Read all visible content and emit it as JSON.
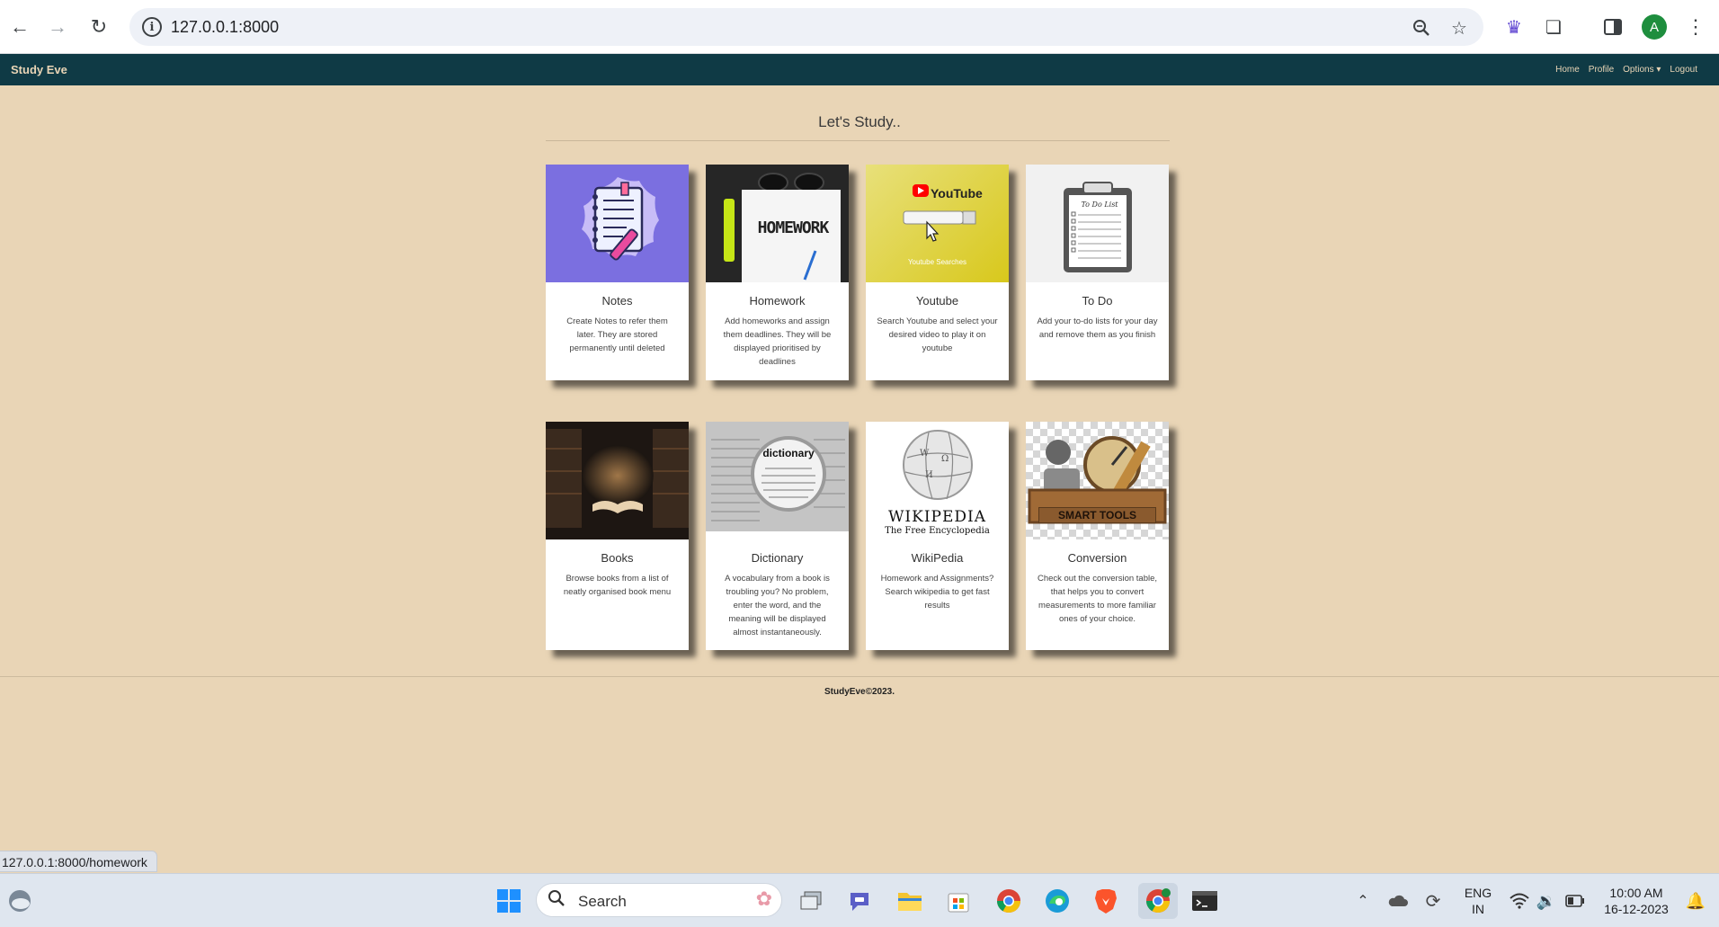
{
  "browser": {
    "url": "127.0.0.1:8000",
    "status_url": "127.0.0.1:8000/homework",
    "avatar_letter": "A"
  },
  "nav": {
    "brand": "Study Eve",
    "links": [
      "Home",
      "Profile",
      "Options ▾",
      "Logout"
    ]
  },
  "main": {
    "heading": "Let's Study..",
    "cards": [
      {
        "title": "Notes",
        "desc": "Create Notes to refer them later. They are stored permanently until deleted",
        "thumb_text": ""
      },
      {
        "title": "Homework",
        "desc": "Add homeworks and assign them deadlines. They will be displayed prioritised by deadlines",
        "thumb_text": "HOMEWORK"
      },
      {
        "title": "Youtube",
        "desc": "Search Youtube and select your desired video to play it on youtube",
        "thumb_text": "YouTube",
        "thumb_caption": "Youtube Searches"
      },
      {
        "title": "To Do",
        "desc": "Add your to-do lists for your day and remove them as you finish",
        "thumb_text": "To Do List"
      },
      {
        "title": "Books",
        "desc": "Browse books from a list of neatly organised book menu",
        "thumb_text": ""
      },
      {
        "title": "Dictionary",
        "desc": "A vocabulary from a book is troubling you? No problem, enter the word, and the meaning will be displayed almost instantaneously.",
        "thumb_text": "dictionary"
      },
      {
        "title": "WikiPedia",
        "desc": "Homework and Assignments? Search wikipedia to get fast results",
        "thumb_text": "WIKIPEDIA",
        "thumb_caption": "The Free Encyclopedia"
      },
      {
        "title": "Conversion",
        "desc": "Check out the conversion table, that helps you to convert measurements to more familiar ones of your choice.",
        "thumb_text": "SMART TOOLS"
      }
    ]
  },
  "footer": {
    "text": "StudyEve©2023."
  },
  "taskbar": {
    "search_label": "Search",
    "lang_line1": "ENG",
    "lang_line2": "IN",
    "time": "10:00 AM",
    "date": "16-12-2023"
  }
}
